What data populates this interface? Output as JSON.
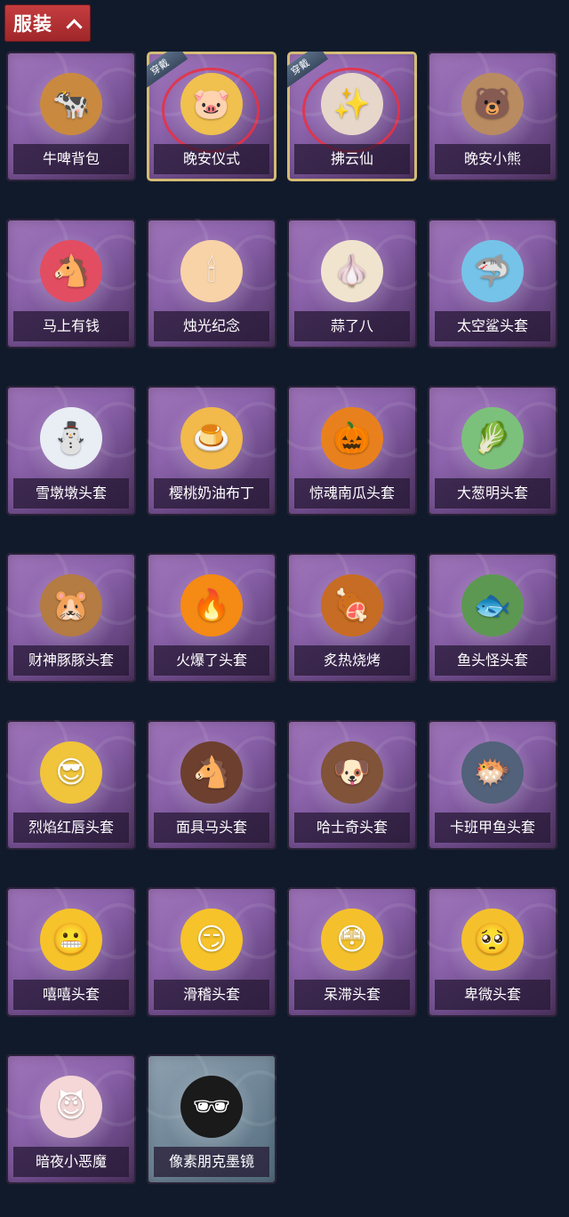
{
  "header": {
    "title": "服装"
  },
  "items": [
    {
      "label": "牛啤背包",
      "icon": "cow-beer-backpack-icon",
      "color": "#c98a3f",
      "symbol": "🐄"
    },
    {
      "label": "晚安仪式",
      "icon": "goodnight-ritual-icon",
      "color": "#f0c14e",
      "symbol": "🐷",
      "badge": "穿戴"
    },
    {
      "label": "拂云仙",
      "icon": "cloud-fairy-icon",
      "color": "#e7d7ca",
      "symbol": "✨",
      "badge": "穿戴"
    },
    {
      "label": "晚安小熊",
      "icon": "goodnight-bear-icon",
      "color": "#b98b61",
      "symbol": "🐻"
    },
    {
      "label": "马上有钱",
      "icon": "money-horse-icon",
      "color": "#e34d61",
      "symbol": "🐴"
    },
    {
      "label": "烛光纪念",
      "icon": "candle-icon",
      "color": "#f8d3a7",
      "symbol": "🕯"
    },
    {
      "label": "蒜了八",
      "icon": "garlic-icon",
      "color": "#f0e4cf",
      "symbol": "🧄"
    },
    {
      "label": "太空鲨头套",
      "icon": "shark-head-icon",
      "color": "#75c3e8",
      "symbol": "🦈"
    },
    {
      "label": "雪墩墩头套",
      "icon": "snowman-head-icon",
      "color": "#e9edf4",
      "symbol": "⛄"
    },
    {
      "label": "樱桃奶油布丁",
      "icon": "pudding-head-icon",
      "color": "#f2b94b",
      "symbol": "🍮"
    },
    {
      "label": "惊魂南瓜头套",
      "icon": "pumpkin-head-icon",
      "color": "#e8811d",
      "symbol": "🎃"
    },
    {
      "label": "大葱明头套",
      "icon": "scallion-head-icon",
      "color": "#7cc17b",
      "symbol": "🥬"
    },
    {
      "label": "财神豚豚头套",
      "icon": "capybara-head-icon",
      "color": "#b47b42",
      "symbol": "🐹"
    },
    {
      "label": "火爆了头套",
      "icon": "fire-head-icon",
      "color": "#f58a14",
      "symbol": "🔥"
    },
    {
      "label": "炙热烧烤",
      "icon": "bbq-head-icon",
      "color": "#c76c24",
      "symbol": "🍖"
    },
    {
      "label": "鱼头怪头套",
      "icon": "fish-head-icon",
      "color": "#5d9852",
      "symbol": "🐟"
    },
    {
      "label": "烈焰红唇头套",
      "icon": "yellow-mask-head-icon",
      "color": "#f0c43b",
      "symbol": "😎"
    },
    {
      "label": "面具马头套",
      "icon": "horse-mask-head-icon",
      "color": "#6d3f2f",
      "symbol": "🐴"
    },
    {
      "label": "哈士奇头套",
      "icon": "husky-head-icon",
      "color": "#815338",
      "symbol": "🐶"
    },
    {
      "label": "卡班甲鱼头套",
      "icon": "blue-fish-head-icon",
      "color": "#51627a",
      "symbol": "🐡"
    },
    {
      "label": "嘻嘻头套",
      "icon": "grin-emoji-head-icon",
      "color": "#f6c32a",
      "symbol": "😬"
    },
    {
      "label": "滑稽头套",
      "icon": "smirk-emoji-head-icon",
      "color": "#f6c32a",
      "symbol": "😏"
    },
    {
      "label": "呆滞头套",
      "icon": "dazed-emoji-head-icon",
      "color": "#f4c12d",
      "symbol": "😳"
    },
    {
      "label": "卑微头套",
      "icon": "humble-emoji-head-icon",
      "color": "#f4c12d",
      "symbol": "🥺"
    },
    {
      "label": "暗夜小恶魔",
      "icon": "little-devil-icon",
      "color": "#f5d7d7",
      "symbol": "😈"
    },
    {
      "label": "像素朋克墨镜",
      "icon": "pixel-sunglasses-icon",
      "color": "#1a1a1a",
      "symbol": "🕶"
    }
  ]
}
